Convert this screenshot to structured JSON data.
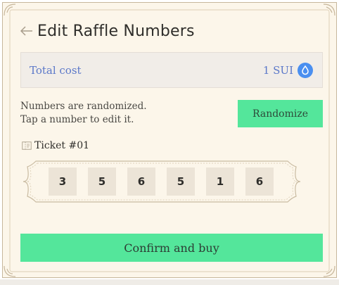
{
  "header": {
    "back_icon": "arrow-left-icon",
    "title": "Edit Raffle Numbers"
  },
  "cost": {
    "label": "Total cost",
    "value": "1 SUI",
    "icon": "sui-coin-icon"
  },
  "helper": {
    "line1": "Numbers are randomized.",
    "line2": "Tap a number to edit it."
  },
  "randomize_label": "Randomize",
  "ticket": {
    "icon": "ticket-icon",
    "label": "Ticket #01",
    "numbers": [
      "3",
      "5",
      "6",
      "5",
      "1",
      "6"
    ]
  },
  "confirm_label": "Confirm and buy",
  "colors": {
    "accent": "#54e69b",
    "link_blue": "#5b78c9",
    "card_bg": "#fcf6ea",
    "sui_blue": "#4a8ff0"
  }
}
